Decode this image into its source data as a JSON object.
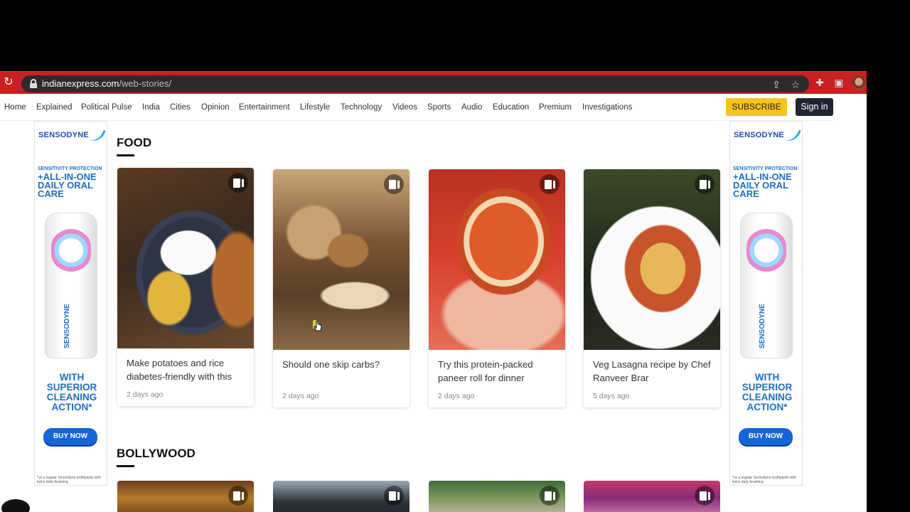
{
  "browser": {
    "url_domain": "indianexpress.com",
    "url_path": "/web-stories/"
  },
  "nav": {
    "items": [
      "Home",
      "Explained",
      "Political Pulse",
      "India",
      "Cities",
      "Opinion",
      "Entertainment",
      "Lifestyle",
      "Technology",
      "Videos",
      "Sports",
      "Audio",
      "Education",
      "Premium",
      "Investigations"
    ],
    "subscribe_label": "SUBSCRIBE",
    "signin_label": "Sign in"
  },
  "ad": {
    "brand": "SENSODYNE",
    "tagline_small": "SENSITIVITY PROTECTION",
    "tagline_big": "+ALL-IN-ONE DAILY ORAL CARE",
    "tube_name": "SENSODYNE",
    "cta": "WITH SUPERIOR CLEANING ACTION*",
    "buy_label": "BUY NOW",
    "fine_print": "*vs a regular Sensodyne toothpaste with twice daily brushing"
  },
  "sections": [
    {
      "title": "FOOD",
      "cards": [
        {
          "title": "Make potatoes and rice diabetes-friendly with this",
          "date": "2 days ago"
        },
        {
          "title": "Should one skip carbs?",
          "date": "2 days ago"
        },
        {
          "title": "Try this protein-packed paneer roll for dinner",
          "date": "2 days ago"
        },
        {
          "title": "Veg Lasagna recipe by Chef Ranveer Brar",
          "date": "5 days ago"
        }
      ]
    },
    {
      "title": "BOLLYWOOD"
    }
  ],
  "colors": {
    "browser_frame": "#c62020",
    "subscribe_bg": "#f7c31a",
    "signin_bg": "#1f2430",
    "ad_blue": "#1d6fc4"
  }
}
